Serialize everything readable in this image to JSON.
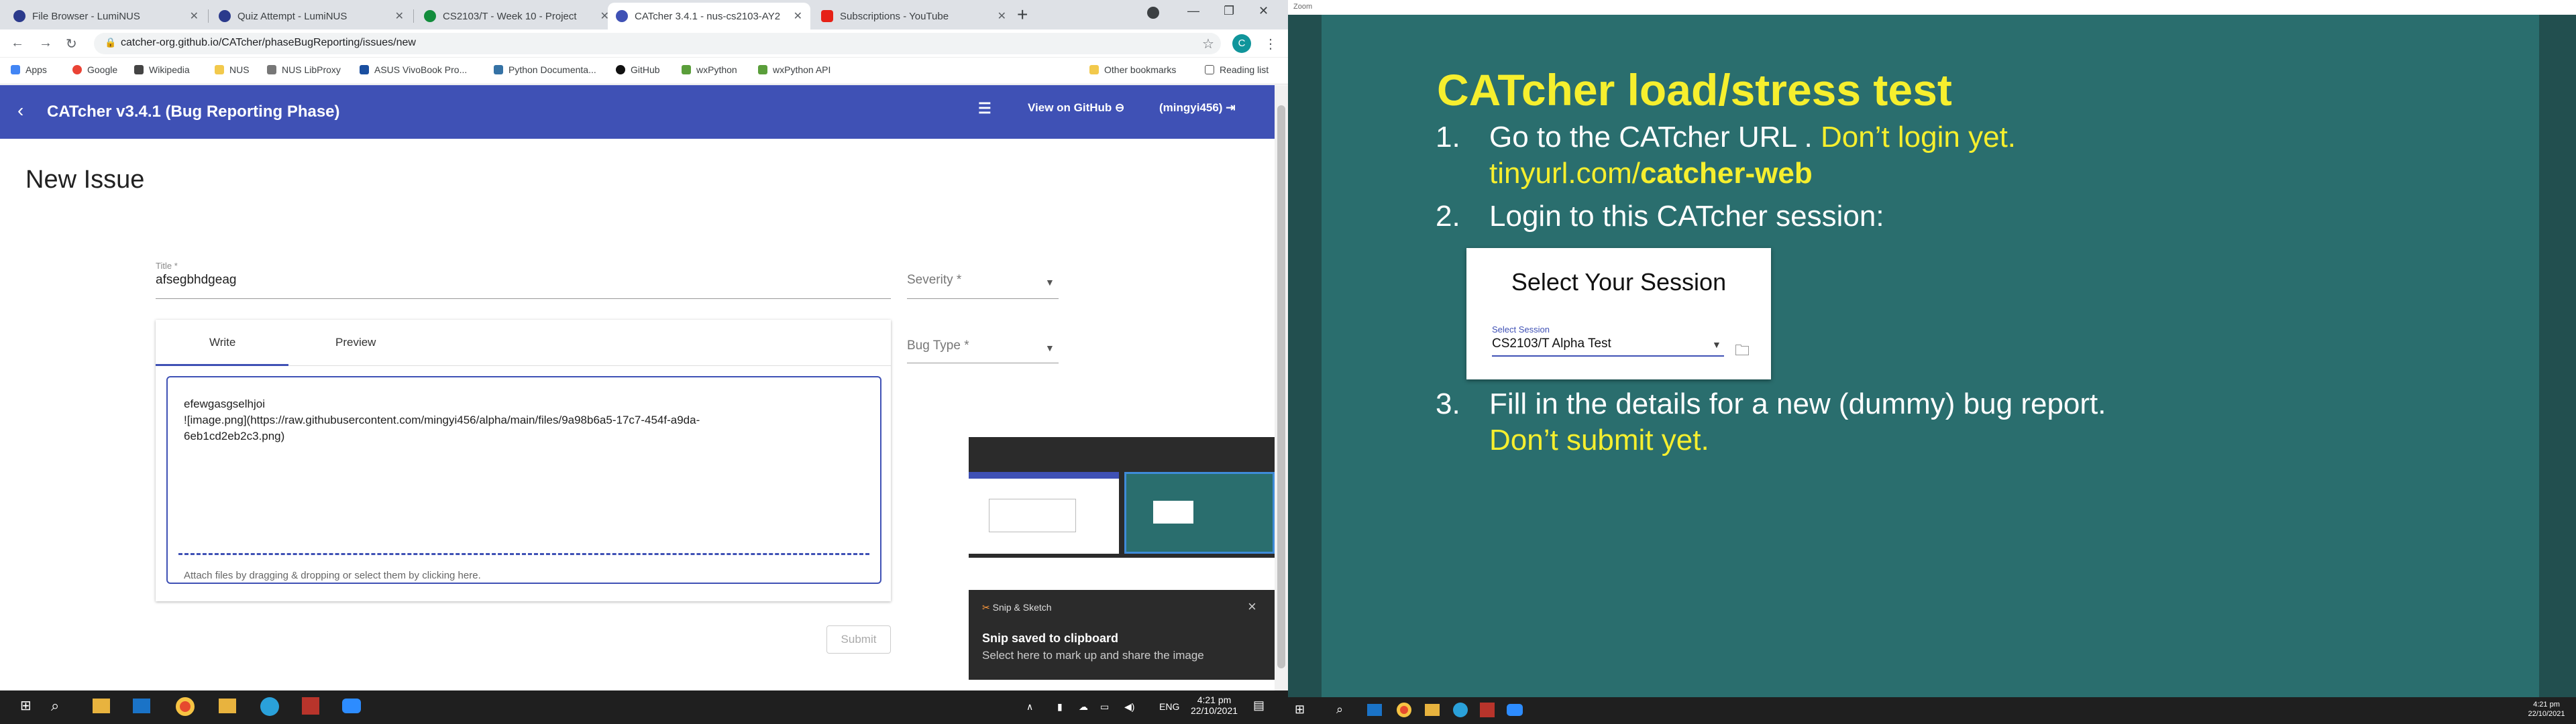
{
  "browser": {
    "tabs": [
      {
        "label": "File Browser - LumiNUS",
        "color": "#2b3a8c"
      },
      {
        "label": "Quiz Attempt - LumiNUS",
        "color": "#2b3a8c"
      },
      {
        "label": "CS2103/T - Week 10 - Project",
        "color": "#128c3c"
      },
      {
        "label": "CATcher 3.4.1 - nus-cs2103-AY2",
        "color": "#3f51b5"
      },
      {
        "label": "Subscriptions - YouTube",
        "color": "#e62117"
      }
    ],
    "url": "catcher-org.github.io/CATcher/phaseBugReporting/issues/new",
    "avatar": "C",
    "bookmarks": [
      "Apps",
      "Google",
      "Wikipedia",
      "NUS",
      "NUS LibProxy",
      "ASUS VivoBook Pro...",
      "Python Documenta...",
      "GitHub",
      "wxPython",
      "wxPython API"
    ],
    "other_bookmarks": "Other bookmarks",
    "reading_list": "Reading list"
  },
  "app": {
    "title": "CATcher v3.4.1  (Bug Reporting Phase)",
    "view_github": "View on GitHub",
    "user": "(mingyi456)",
    "page_heading": "New Issue",
    "title_label": "Title *",
    "title_value": "afsegbhdgeag",
    "severity_label": "Severity *",
    "bugtype_label": "Bug Type *",
    "tab_write": "Write",
    "tab_preview": "Preview",
    "desc_line1": "efewgasgselhjoi",
    "desc_line2": "![image.png](https://raw.githubusercontent.com/mingyi456/alpha/main/files/9a98b6a5-17c7-454f-a9da-",
    "desc_line3": "6eb1cd2eb2c3.png)",
    "attach_hint": "Attach files by dragging & dropping or select them by clicking here.",
    "submit": "Submit"
  },
  "snip": {
    "app": "Snip & Sketch",
    "heading": "Snip saved to clipboard",
    "sub": "Select here to mark up and share the image",
    "close": "×"
  },
  "taskbar_left": {
    "lang": "ENG",
    "time": "4:21 pm",
    "date": "22/10/2021"
  },
  "taskbar_right": {
    "time": "4:21 pm",
    "date": "22/10/2021"
  },
  "zoom_title": "Zoom",
  "slide": {
    "title": "CATcher load/stress test",
    "items": [
      {
        "n": "1.",
        "text": "Go to the CATcher URL . ",
        "yellow": "Don’t login yet."
      },
      {
        "n": "",
        "text": "",
        "yellow": "tinyurl.com/",
        "yellow_bold": "catcher-web"
      },
      {
        "n": "2.",
        "text": "Login to this CATcher session:"
      },
      {
        "n": "3.",
        "text": "Fill in the details for a new (dummy) bug report."
      },
      {
        "n": "",
        "yellow": "Don’t submit yet."
      }
    ],
    "session_box": {
      "heading": "Select Your Session",
      "label": "Select Session",
      "value": "CS2103/T Alpha Test"
    }
  }
}
